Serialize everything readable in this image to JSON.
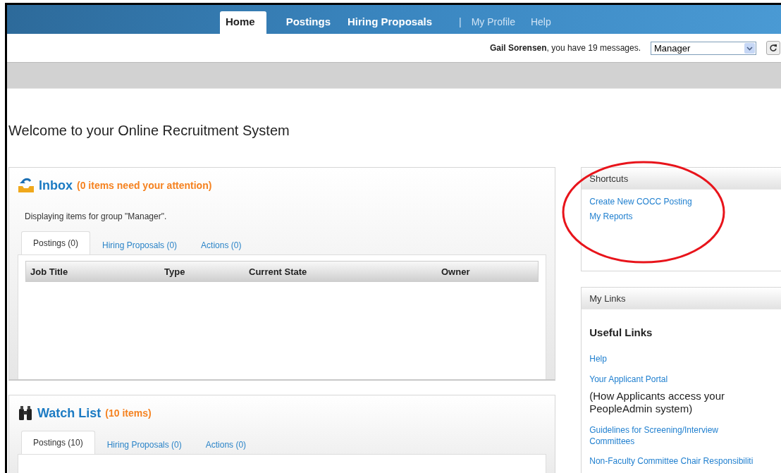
{
  "nav": {
    "items": [
      {
        "label": "Home",
        "kind": "primary",
        "selected": true
      },
      {
        "label": "Postings",
        "kind": "primary",
        "selected": false
      },
      {
        "label": "Hiring Proposals",
        "kind": "primary",
        "selected": false
      },
      {
        "label": "|",
        "kind": "separator",
        "selected": false
      },
      {
        "label": "My Profile",
        "kind": "secondary",
        "selected": false
      },
      {
        "label": "Help",
        "kind": "secondary",
        "selected": false
      }
    ]
  },
  "user_bar": {
    "greeting": "**Gail Sorensen**, you have 19 messages.",
    "role_select": {
      "value": "Manager"
    }
  },
  "page_title": "Welcome to your Online Recruitment System",
  "inbox": {
    "title": "Inbox",
    "count": "(0 items need your attention)",
    "note": "Displaying items for group \"Manager\".",
    "tabs": [
      {
        "label": "Postings (0)",
        "selected": true
      },
      {
        "label": "Hiring Proposals (0)",
        "selected": false
      },
      {
        "label": "Actions (0)",
        "selected": false
      }
    ],
    "table": {
      "columns": [
        "Job Title",
        "Type",
        "Current State",
        "Owner"
      ]
    }
  },
  "watch_list": {
    "title": "Watch List",
    "count": "(10 items)",
    "tabs": [
      {
        "label": "Postings (10)",
        "selected": true
      },
      {
        "label": "Hiring Proposals (0)",
        "selected": false
      },
      {
        "label": "Actions (0)",
        "selected": false
      }
    ]
  },
  "shortcuts": {
    "title": "Shortcuts",
    "links": [
      "Create New COCC Posting",
      "My Reports"
    ]
  },
  "my_links": {
    "title": "My Links",
    "heading": "Useful Links",
    "items": [
      {
        "link": "Help"
      },
      {
        "link": "Your Applicant Portal",
        "note": "(How Applicants access your PeopleAdmin system)"
      },
      {
        "link": "Guidelines for Screening/Interview Committees"
      },
      {
        "link": "Non-Faculty Committee Chair Responsibiliti"
      }
    ]
  }
}
